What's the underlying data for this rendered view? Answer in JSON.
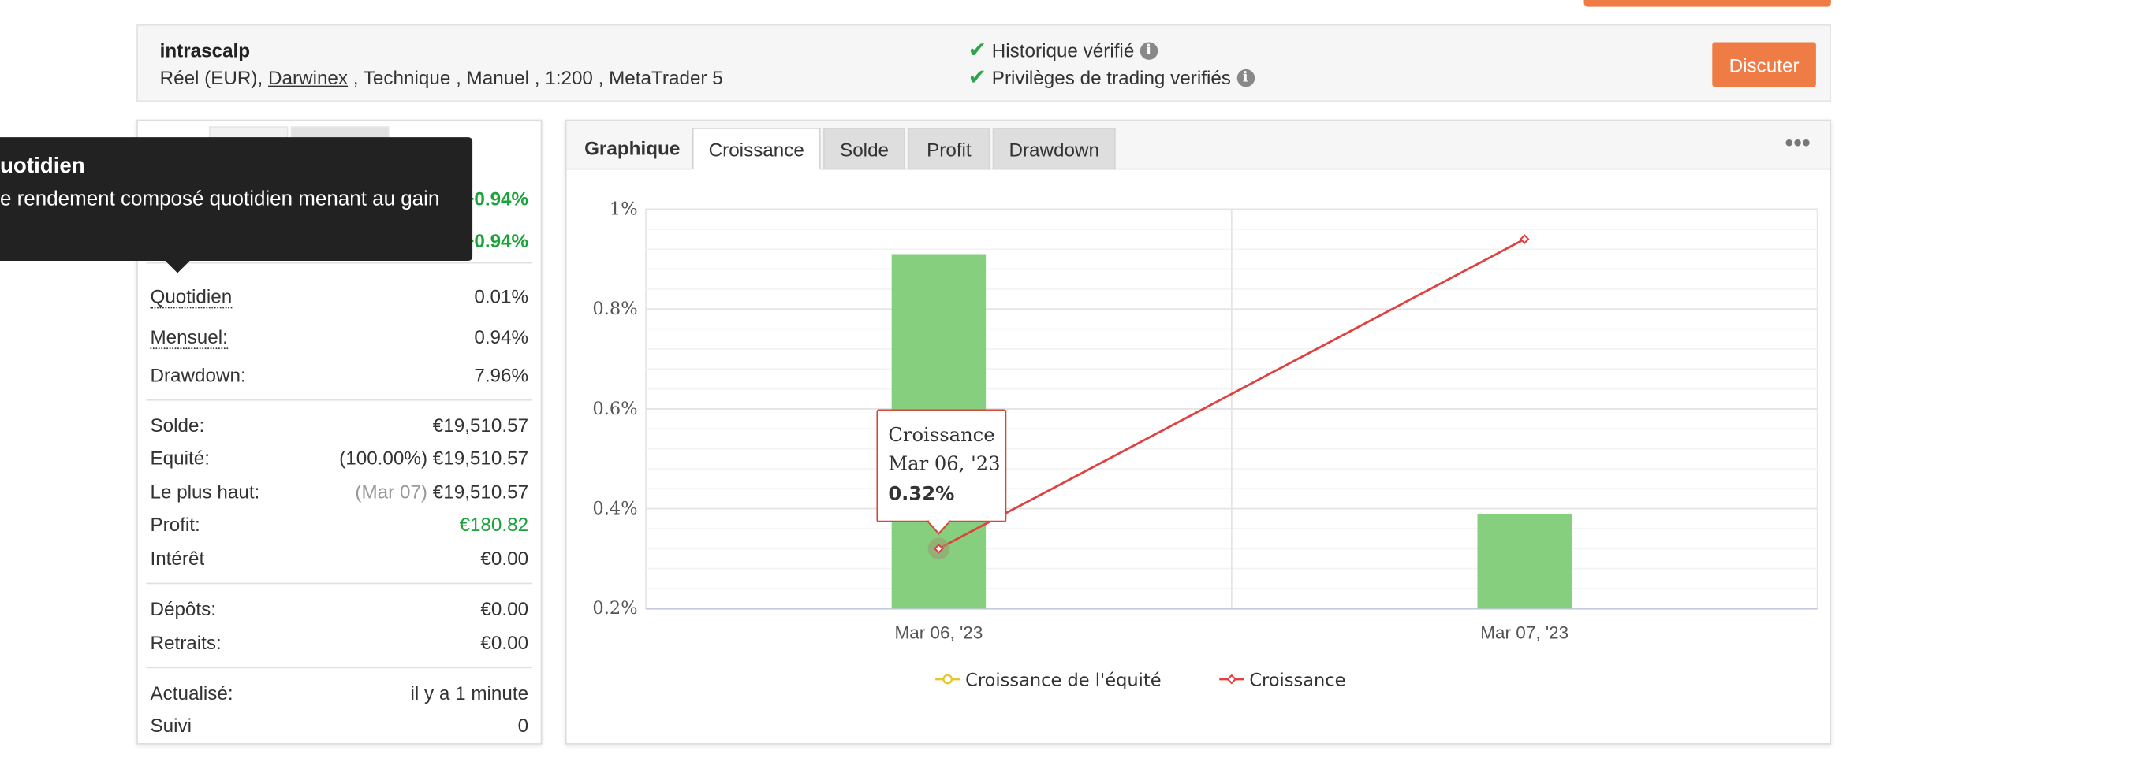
{
  "account": {
    "name": "intrascalp",
    "details_before": "Réel (EUR), ",
    "broker": "Darwinex",
    "details_after": " , Technique , Manuel , 1:200 , MetaTrader 5",
    "verified_history": "Historique vérifié",
    "verified_privileges": "Privilèges de trading verifiés",
    "discuss_label": "Discuter"
  },
  "tooltip": {
    "title": "uotidien",
    "text": "e rendement composé quotidien menant au gain"
  },
  "stats": {
    "gain_value": "+0.94%",
    "abs_gain_value": "+0.94%",
    "daily_label": "Quotidien",
    "daily_value": "0.01%",
    "monthly_label": "Mensuel:",
    "monthly_value": "0.94%",
    "drawdown_label": "Drawdown:",
    "drawdown_value": "7.96%",
    "balance_label": "Solde:",
    "balance_value": "€19,510.57",
    "equity_label": "Equité:",
    "equity_pct": "(100.00%)",
    "equity_value": "€19,510.57",
    "highest_label": "Le plus haut:",
    "highest_date": "(Mar 07)",
    "highest_value": "€19,510.57",
    "profit_label": "Profit:",
    "profit_value": "€180.82",
    "interest_label": "Intérêt",
    "interest_value": "€0.00",
    "deposits_label": "Dépôts:",
    "deposits_value": "€0.00",
    "withdrawals_label": "Retraits:",
    "withdrawals_value": "€0.00",
    "updated_label": "Actualisé:",
    "updated_value": "il y a 1 minute",
    "tracking_label": "Suivi",
    "tracking_value": "0"
  },
  "chart_tabs": {
    "static_label": "Graphique",
    "tabs": [
      "Croissance",
      "Solde",
      "Profit",
      "Drawdown"
    ],
    "active": "Croissance",
    "more_icon": "ellipsis-icon"
  },
  "chart_data": {
    "type": "bar",
    "categories": [
      "Mar 06, '23",
      "Mar 07, '23"
    ],
    "series": [
      {
        "name": "Croissance",
        "type": "bar",
        "values": [
          0.91,
          0.39
        ],
        "color": "#86cf7e"
      },
      {
        "name": "Croissance",
        "type": "line",
        "values": [
          0.32,
          0.94
        ],
        "color": "#e04040"
      },
      {
        "name": "Croissance de l'équité",
        "type": "line",
        "values": [],
        "color": "#e8c630"
      }
    ],
    "y_ticks": [
      "0.2%",
      "0.4%",
      "0.6%",
      "0.8%",
      "1%"
    ],
    "ylim": [
      0.2,
      1.0
    ],
    "grid": true,
    "legend": {
      "position": "bottom",
      "items": [
        {
          "label": "Croissance de l'équité",
          "color": "#e8c630"
        },
        {
          "label": "Croissance",
          "color": "#e04040"
        }
      ]
    },
    "hover_tooltip": {
      "series": "Croissance",
      "date": "Mar 06, '23",
      "value": "0.32%"
    }
  }
}
